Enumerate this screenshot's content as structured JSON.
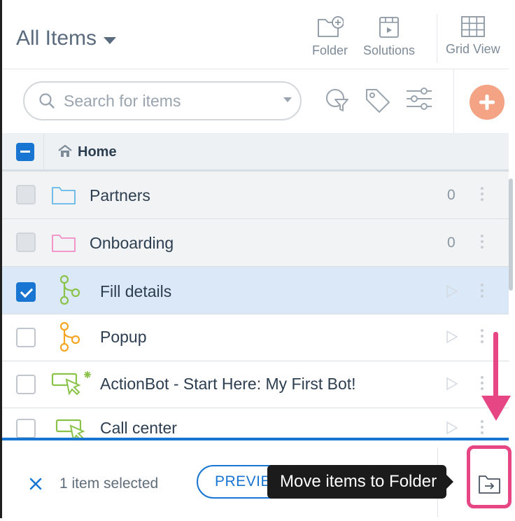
{
  "header": {
    "title": "All Items",
    "buttons": [
      {
        "label": "Folder",
        "icon": "folder-add-icon"
      },
      {
        "label": "Solutions",
        "icon": "solutions-icon"
      },
      {
        "label": "Grid View",
        "icon": "grid-view-icon"
      }
    ]
  },
  "search": {
    "placeholder": "Search for items"
  },
  "toolbar": {
    "icons": [
      "filter-icon",
      "tag-icon",
      "sliders-icon",
      "add-icon"
    ]
  },
  "breadcrumb": {
    "label": "Home"
  },
  "list": [
    {
      "name": "Partners",
      "type": "folder",
      "folder_color": "#63b7e6",
      "count": "0",
      "checked": false
    },
    {
      "name": "Onboarding",
      "type": "folder",
      "folder_color": "#f28cc5",
      "count": "0",
      "checked": false
    },
    {
      "name": "Fill details",
      "type": "flow",
      "icon_color": "#8bc34a",
      "checked": true
    },
    {
      "name": "Popup",
      "type": "flow",
      "icon_color": "#f5a623",
      "checked": false
    },
    {
      "name": "ActionBot - Start Here: My First Bot!",
      "type": "bot",
      "icon_color": "#8bc34a",
      "checked": false
    },
    {
      "name": "Call center",
      "type": "bot",
      "icon_color": "#8bc34a",
      "checked": false
    }
  ],
  "bottom": {
    "selection_text": "1 item selected",
    "preview_label": "PREVIEW",
    "tooltip": "Move items to Folder"
  },
  "colors": {
    "accent": "#1876d2",
    "annotation": "#e64784",
    "add_button": "#f4a384"
  }
}
